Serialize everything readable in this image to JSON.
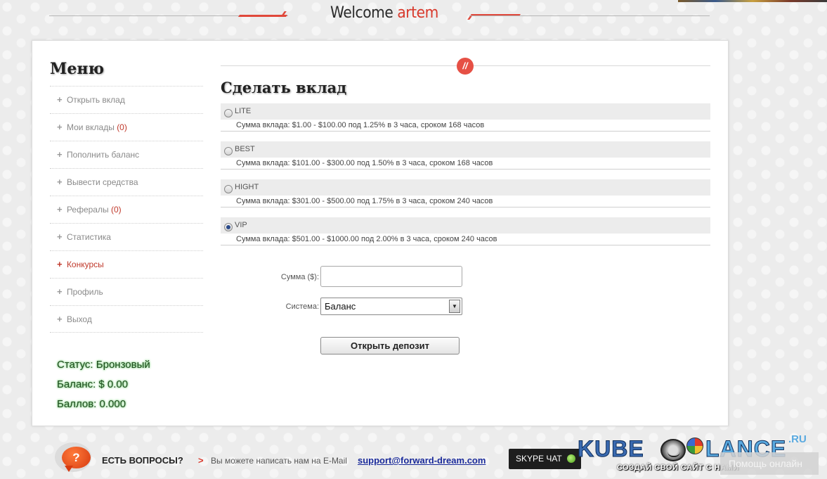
{
  "header": {
    "welcome_prefix": "Welcome",
    "username": "artem"
  },
  "menu": {
    "title": "Меню",
    "items": [
      {
        "label": "Открыть вклад",
        "count": null,
        "active": false
      },
      {
        "label": "Мои вклады",
        "count": "(0)",
        "active": false
      },
      {
        "label": "Пополнить баланс",
        "count": null,
        "active": false
      },
      {
        "label": "Вывести средства",
        "count": null,
        "active": false
      },
      {
        "label": "Рефералы",
        "count": "(0)",
        "active": false
      },
      {
        "label": "Статистика",
        "count": null,
        "active": false
      },
      {
        "label": "Конкурсы",
        "count": null,
        "active": true
      },
      {
        "label": "Профиль",
        "count": null,
        "active": false
      },
      {
        "label": "Выход",
        "count": null,
        "active": false
      }
    ]
  },
  "user_stats": {
    "status": "Статус: Бронзовый",
    "balance": "Баланс: $ 0.00",
    "points": "Баллов: 0.000"
  },
  "deposit": {
    "title": "Сделать вклад",
    "deco_icon": "//",
    "plans": [
      {
        "name": "LITE",
        "description": "Сумма вклада: $1.00 - $100.00 под 1.25% в 3 часа, сроком 168 часов",
        "selected": false
      },
      {
        "name": "BEST",
        "description": "Сумма вклада: $101.00 - $300.00 под 1.50% в 3 часа, сроком 168 часов",
        "selected": false
      },
      {
        "name": "HIGHT",
        "description": "Сумма вклада: $301.00 - $500.00 под 1.75% в 3 часа, сроком 240 часов",
        "selected": false
      },
      {
        "name": "VIP",
        "description": "Сумма вклада: $501.00 - $1000.00 под 2.00% в 3 часа, сроком 240 часов",
        "selected": true
      }
    ],
    "sum_label": "Сумма ($):",
    "sum_value": "",
    "system_label": "Система:",
    "system_value": "Баланс",
    "submit_label": "Открыть депозит"
  },
  "footer": {
    "question_icon": "?",
    "question_label": "ЕСТЬ ВОПРОСЫ?",
    "arrow": ">",
    "email_text": "Вы можете написать нам на E-Mail",
    "email": "support@forward-dream.com",
    "skype_label": "SKYPE ЧАТ",
    "logo_kube": "KUBE",
    "logo_lance": "LANCE",
    "logo_ru": ".RU",
    "logo_tagline": "СОЗДАЙ СВОЙ САЙТ С НАМИ",
    "help_online": "Помощь онлайн"
  },
  "colors": {
    "accent_red": "#d8392c",
    "status_green": "#1f4d1f",
    "email_blue": "#1a2a9a"
  }
}
